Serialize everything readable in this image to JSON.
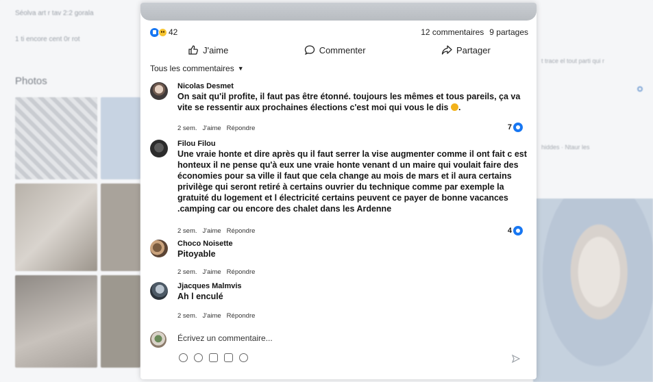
{
  "background": {
    "line1": "Séolva art r tav 2:2 gorala",
    "line2": "1 ti encore cent 0r rot",
    "photos_title": "Photos",
    "right_text1": "t trace el tout parti qui r",
    "right_text2": "hiddes · Ntaur les"
  },
  "post": {
    "reaction_count": "42",
    "comments_count": "12 commentaires",
    "shares_count": "9 partages",
    "actions": {
      "like": "J'aime",
      "comment": "Commenter",
      "share": "Partager"
    },
    "sort_label": "Tous les commentaires"
  },
  "comments": [
    {
      "author": "Nicolas Desmet",
      "text": "On sait qu'il profite, il faut pas être étonné. toujours les mêmes et tous pareils, ça va vite se ressentir aux prochaines élections c'est moi qui vous le dis",
      "time": "2 sem.",
      "like_label": "J'aime",
      "reply_label": "Répondre",
      "reactions": "7"
    },
    {
      "author": "Filou Filou",
      "text": "Une vraie honte et dire après qu il faut serrer la vise augmenter comme il ont fait c est honteux il ne pense qu'à eux une vraie honte venant d un maire qui voulait faire des économies pour sa ville il faut que cela change au mois de mars et il aura certains privilège qui seront retiré à certains ouvrier du technique comme par exemple la gratuité du logement et l électricité certains peuvent ce payer de bonne vacances .camping car ou encore des chalet dans les Ardenne",
      "time": "2 sem.",
      "like_label": "J'aime",
      "reply_label": "Répondre",
      "reactions": "4"
    },
    {
      "author": "Choco Noisette",
      "text": "Pitoyable",
      "time": "2 sem.",
      "like_label": "J'aime",
      "reply_label": "Répondre",
      "reactions": ""
    },
    {
      "author": "Jjacques Malmvis",
      "text": "Ah l enculé",
      "time": "2 sem.",
      "like_label": "J'aime",
      "reply_label": "Répondre",
      "reactions": ""
    }
  ],
  "composer": {
    "placeholder": "Écrivez un commentaire..."
  },
  "colors": {
    "accent": "#1877f2",
    "wow": "#f7c531"
  }
}
